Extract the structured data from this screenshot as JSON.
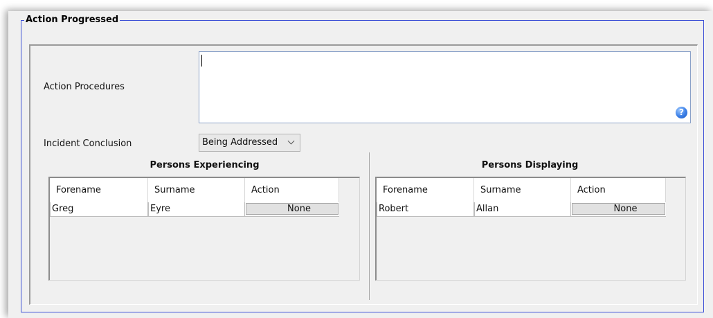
{
  "form": {
    "legend": "Action Progressed",
    "action_procedures_label": "Action Procedures",
    "action_procedures_value": "",
    "incident_conclusion_label": "Incident Conclusion",
    "incident_conclusion_value": "Being Addressed",
    "help_glyph": "?"
  },
  "experiencing": {
    "title": "Persons Experiencing",
    "columns": [
      "Forename",
      "Surname",
      "Action"
    ],
    "rows": [
      {
        "forename": "Greg",
        "surname": "Eyre",
        "action": "None"
      }
    ]
  },
  "displaying": {
    "title": "Persons Displaying",
    "columns": [
      "Forename",
      "Surname",
      "Action"
    ],
    "rows": [
      {
        "forename": "Robert",
        "surname": "Allan",
        "action": "None"
      }
    ]
  },
  "icons": {
    "help": "help-icon",
    "dropdown": "chevron-down-icon"
  },
  "colors": {
    "fieldset_border": "#3b4fd6",
    "help_icon": "#3a7ee6"
  }
}
